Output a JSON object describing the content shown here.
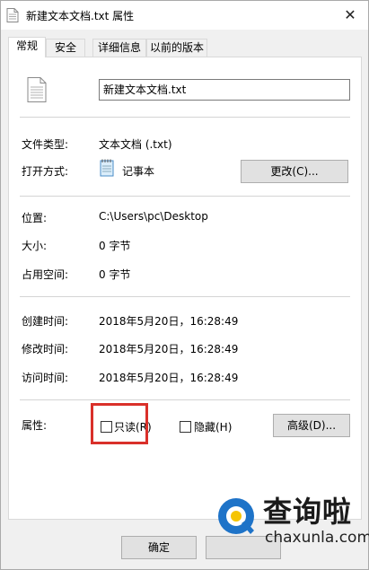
{
  "window": {
    "title": "新建文本文档.txt 属性",
    "close_glyph": "✕"
  },
  "tabs": [
    {
      "label": "常规",
      "active": true
    },
    {
      "label": "安全",
      "active": false
    },
    {
      "label": "详细信息",
      "active": false
    },
    {
      "label": "以前的版本",
      "active": false
    }
  ],
  "general": {
    "file_name": "新建文本文档.txt",
    "type_label": "文件类型:",
    "type_value": "文本文档 (.txt)",
    "opens_with_label": "打开方式:",
    "opens_with_value": "记事本",
    "change_button": "更改(C)...",
    "location_label": "位置:",
    "location_value": "C:\\Users\\pc\\Desktop",
    "size_label": "大小:",
    "size_value": "0 字节",
    "size_on_disk_label": "占用空间:",
    "size_on_disk_value": "0 字节",
    "created_label": "创建时间:",
    "created_value": "2018年5月20日，16:28:49",
    "modified_label": "修改时间:",
    "modified_value": "2018年5月20日，16:28:49",
    "accessed_label": "访问时间:",
    "accessed_value": "2018年5月20日，16:28:49",
    "attributes_label": "属性:",
    "readonly_label": "只读(R)",
    "readonly_checked": false,
    "hidden_label": "隐藏(H)",
    "hidden_checked": false,
    "advanced_button": "高级(D)..."
  },
  "footer": {
    "ok_button": "确定"
  },
  "watermark": {
    "title": "查询啦",
    "url": "chaxunla.com"
  },
  "colors": {
    "highlight": "#d9302a",
    "watermark_blue": "#1e73c8",
    "watermark_yellow": "#f5c400"
  }
}
